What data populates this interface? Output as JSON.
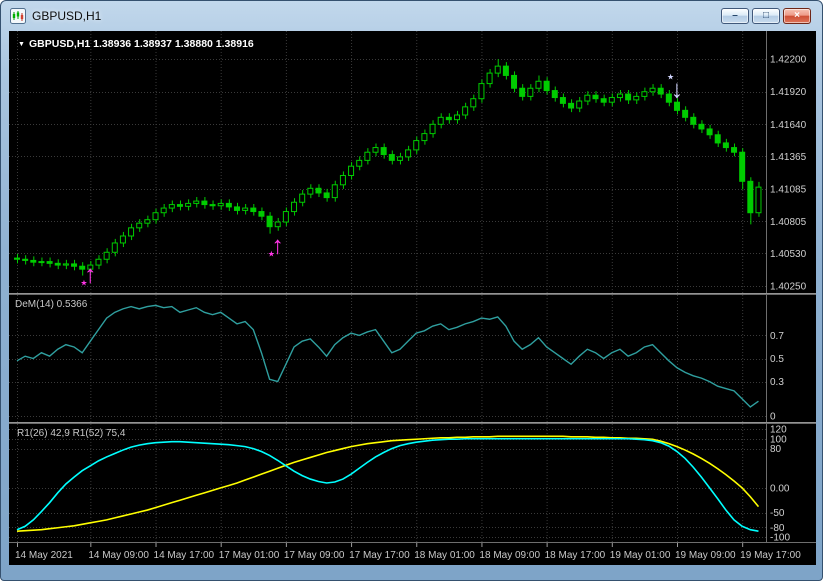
{
  "window": {
    "title": "GBPUSD,H1",
    "buttons": {
      "minimize_glyph": "–",
      "maximize_glyph": "□",
      "close_glyph": "×"
    }
  },
  "main_panel": {
    "ohlc_marker": "▼",
    "ohlc_text": "GBPUSD,H1  1.38936 1.38937 1.38880 1.38916",
    "axis": [
      [
        "1.42200",
        1.422
      ],
      [
        "1.41920",
        1.4192
      ],
      [
        "1.41640",
        1.4164
      ],
      [
        "1.41365",
        1.41365
      ],
      [
        "1.41085",
        1.41085
      ],
      [
        "1.40805",
        1.40805
      ],
      [
        "1.40530",
        1.4053
      ],
      [
        "1.40250",
        1.4025
      ]
    ],
    "range": {
      "max": 1.42442,
      "min": 1.4019
    }
  },
  "dem_panel": {
    "label": "DeM(14) 0.5366",
    "axis": [
      [
        "0.7",
        0.7
      ],
      [
        "0.5",
        0.5
      ],
      [
        "0.3",
        0.3
      ],
      [
        "0",
        0
      ]
    ],
    "range": {
      "max": 1.05,
      "min": -0.05
    }
  },
  "osc_panel": {
    "label": "R1(26) 42,9   R1(52) 75,4",
    "axis": [
      [
        "120",
        120
      ],
      [
        "100",
        100
      ],
      [
        "80",
        80
      ],
      [
        "0.00",
        0
      ],
      [
        "-50",
        -50
      ],
      [
        "-80",
        -80
      ],
      [
        "-100",
        -100
      ]
    ],
    "range": {
      "max": 130,
      "min": -110
    }
  },
  "time_axis": {
    "labels": [
      "14 May 2021",
      "14 May 09:00",
      "14 May 17:00",
      "17 May 01:00",
      "17 May 09:00",
      "17 May 17:00",
      "18 May 01:00",
      "18 May 09:00",
      "18 May 17:00",
      "19 May 01:00",
      "19 May 09:00",
      "19 May 17:00"
    ],
    "tick_indices": [
      0,
      9,
      17,
      25,
      33,
      41,
      49,
      57,
      65,
      73,
      81,
      89
    ]
  },
  "colors": {
    "bg": "#000000",
    "grid": "#3a3a3a",
    "axis_text": "#d0d0d0",
    "axis_line": "#6e6e6e",
    "candle": "#00cc00",
    "candle_bull_fill": "#000000",
    "dem_line": "#2f9f9f",
    "osc_fast": "#00ffff",
    "osc_slow": "#ffff00",
    "ohlc_text": "#ffffff",
    "label_text": "#c8c8c8",
    "time_text": "#c8c8c8",
    "tick": "#9a9a9a"
  },
  "chart_data": {
    "type": "candlestick",
    "symbol": "GBPUSD",
    "timeframe": "H1",
    "title": "GBPUSD,H1",
    "price_range": [
      1.4019,
      1.42442
    ],
    "candles": [
      [
        1.4049,
        1.40525,
        1.40445,
        1.4048
      ],
      [
        1.4048,
        1.40515,
        1.40435,
        1.4047
      ],
      [
        1.4047,
        1.40505,
        1.4042,
        1.40455
      ],
      [
        1.40455,
        1.40495,
        1.4042,
        1.4046
      ],
      [
        1.4046,
        1.40495,
        1.4041,
        1.40445
      ],
      [
        1.40445,
        1.4048,
        1.40395,
        1.4043
      ],
      [
        1.4043,
        1.40475,
        1.40395,
        1.4044
      ],
      [
        1.4044,
        1.40475,
        1.40385,
        1.4042
      ],
      [
        1.4042,
        1.40455,
        1.4034,
        1.40395
      ],
      [
        1.40395,
        1.40465,
        1.4036,
        1.4043
      ],
      [
        1.4043,
        1.40515,
        1.40395,
        1.4048
      ],
      [
        1.4048,
        1.40575,
        1.40445,
        1.4054
      ],
      [
        1.4054,
        1.40655,
        1.40505,
        1.4062
      ],
      [
        1.4062,
        1.40715,
        1.40585,
        1.4068
      ],
      [
        1.4068,
        1.40785,
        1.40645,
        1.4075
      ],
      [
        1.4075,
        1.40825,
        1.40715,
        1.4079
      ],
      [
        1.4079,
        1.40855,
        1.40755,
        1.4082
      ],
      [
        1.4082,
        1.40915,
        1.40785,
        1.4088
      ],
      [
        1.4088,
        1.40955,
        1.40845,
        1.4092
      ],
      [
        1.4092,
        1.40985,
        1.40885,
        1.4095
      ],
      [
        1.4095,
        1.40985,
        1.409,
        1.40935
      ],
      [
        1.40935,
        1.40995,
        1.409,
        1.4096
      ],
      [
        1.4096,
        1.41015,
        1.40925,
        1.4098
      ],
      [
        1.4098,
        1.41015,
        1.40915,
        1.4095
      ],
      [
        1.4095,
        1.40985,
        1.40905,
        1.4094
      ],
      [
        1.4094,
        1.40995,
        1.40905,
        1.4096
      ],
      [
        1.4096,
        1.40995,
        1.40895,
        1.4093
      ],
      [
        1.4093,
        1.40965,
        1.40865,
        1.409
      ],
      [
        1.409,
        1.40955,
        1.40865,
        1.4092
      ],
      [
        1.4092,
        1.40955,
        1.40855,
        1.4089
      ],
      [
        1.4089,
        1.40925,
        1.40815,
        1.4085
      ],
      [
        1.4085,
        1.40885,
        1.407,
        1.4076
      ],
      [
        1.4076,
        1.40835,
        1.40725,
        1.408
      ],
      [
        1.408,
        1.40925,
        1.40765,
        1.4089
      ],
      [
        1.4089,
        1.41005,
        1.40855,
        1.4097
      ],
      [
        1.4097,
        1.41075,
        1.40935,
        1.4104
      ],
      [
        1.4104,
        1.41125,
        1.41005,
        1.4109
      ],
      [
        1.4109,
        1.41125,
        1.41015,
        1.4105
      ],
      [
        1.4105,
        1.41085,
        1.40975,
        1.4101
      ],
      [
        1.4101,
        1.41155,
        1.40975,
        1.4112
      ],
      [
        1.4112,
        1.41235,
        1.41085,
        1.412
      ],
      [
        1.412,
        1.41315,
        1.41165,
        1.4128
      ],
      [
        1.4128,
        1.41365,
        1.41245,
        1.4133
      ],
      [
        1.4133,
        1.41435,
        1.41295,
        1.414
      ],
      [
        1.414,
        1.41475,
        1.41365,
        1.4144
      ],
      [
        1.4144,
        1.41475,
        1.41345,
        1.4138
      ],
      [
        1.4138,
        1.41415,
        1.41295,
        1.4133
      ],
      [
        1.4133,
        1.41395,
        1.41295,
        1.4136
      ],
      [
        1.4136,
        1.41455,
        1.41325,
        1.4142
      ],
      [
        1.4142,
        1.41535,
        1.41385,
        1.415
      ],
      [
        1.415,
        1.41595,
        1.41465,
        1.4156
      ],
      [
        1.4156,
        1.41675,
        1.41525,
        1.4164
      ],
      [
        1.4164,
        1.41735,
        1.41605,
        1.417
      ],
      [
        1.417,
        1.41735,
        1.41645,
        1.4168
      ],
      [
        1.4168,
        1.41755,
        1.41645,
        1.4172
      ],
      [
        1.4172,
        1.41825,
        1.41685,
        1.4179
      ],
      [
        1.4179,
        1.41895,
        1.41755,
        1.4186
      ],
      [
        1.4186,
        1.42025,
        1.41825,
        1.4199
      ],
      [
        1.4199,
        1.42115,
        1.41955,
        1.4208
      ],
      [
        1.4208,
        1.422,
        1.42045,
        1.4214
      ],
      [
        1.4214,
        1.42175,
        1.42025,
        1.4206
      ],
      [
        1.4206,
        1.42095,
        1.41915,
        1.4195
      ],
      [
        1.4195,
        1.41985,
        1.41845,
        1.4188
      ],
      [
        1.4188,
        1.41985,
        1.41845,
        1.4195
      ],
      [
        1.4195,
        1.4206,
        1.41915,
        1.4201
      ],
      [
        1.4201,
        1.42045,
        1.41895,
        1.4193
      ],
      [
        1.4193,
        1.41965,
        1.41835,
        1.4187
      ],
      [
        1.4187,
        1.41905,
        1.41785,
        1.4182
      ],
      [
        1.4182,
        1.41855,
        1.41745,
        1.4178
      ],
      [
        1.4178,
        1.41875,
        1.41745,
        1.4184
      ],
      [
        1.4184,
        1.41925,
        1.41805,
        1.4189
      ],
      [
        1.4189,
        1.41925,
        1.41825,
        1.4186
      ],
      [
        1.4186,
        1.41895,
        1.41795,
        1.4183
      ],
      [
        1.4183,
        1.41905,
        1.41795,
        1.4187
      ],
      [
        1.4187,
        1.41935,
        1.41835,
        1.419
      ],
      [
        1.419,
        1.41935,
        1.41815,
        1.4185
      ],
      [
        1.4185,
        1.41915,
        1.41815,
        1.4188
      ],
      [
        1.4188,
        1.41955,
        1.41845,
        1.4192
      ],
      [
        1.4192,
        1.41985,
        1.41885,
        1.4195
      ],
      [
        1.4195,
        1.41985,
        1.41865,
        1.419
      ],
      [
        1.419,
        1.41935,
        1.41795,
        1.4183
      ],
      [
        1.4183,
        1.41865,
        1.41725,
        1.4176
      ],
      [
        1.4176,
        1.41795,
        1.41665,
        1.417
      ],
      [
        1.417,
        1.41735,
        1.41605,
        1.4164
      ],
      [
        1.4164,
        1.41675,
        1.41565,
        1.416
      ],
      [
        1.416,
        1.41635,
        1.41515,
        1.4155
      ],
      [
        1.4155,
        1.41585,
        1.41445,
        1.4148
      ],
      [
        1.4148,
        1.41515,
        1.41405,
        1.4144
      ],
      [
        1.4144,
        1.41475,
        1.41365,
        1.414
      ],
      [
        1.414,
        1.41435,
        1.4108,
        1.4115
      ],
      [
        1.4115,
        1.41185,
        1.4078,
        1.4088
      ],
      [
        1.4088,
        1.41145,
        1.40845,
        1.411
      ]
    ],
    "dem": [
      0.48,
      0.52,
      0.5,
      0.55,
      0.52,
      0.58,
      0.62,
      0.6,
      0.55,
      0.65,
      0.75,
      0.85,
      0.9,
      0.93,
      0.95,
      0.93,
      0.95,
      0.96,
      0.94,
      0.95,
      0.9,
      0.92,
      0.94,
      0.9,
      0.88,
      0.9,
      0.85,
      0.8,
      0.82,
      0.75,
      0.55,
      0.32,
      0.3,
      0.45,
      0.6,
      0.65,
      0.67,
      0.6,
      0.52,
      0.62,
      0.68,
      0.72,
      0.7,
      0.73,
      0.75,
      0.65,
      0.55,
      0.58,
      0.65,
      0.72,
      0.74,
      0.78,
      0.8,
      0.75,
      0.77,
      0.8,
      0.82,
      0.85,
      0.84,
      0.86,
      0.78,
      0.65,
      0.58,
      0.62,
      0.68,
      0.6,
      0.55,
      0.5,
      0.45,
      0.52,
      0.58,
      0.55,
      0.5,
      0.55,
      0.58,
      0.52,
      0.55,
      0.6,
      0.62,
      0.55,
      0.48,
      0.42,
      0.38,
      0.35,
      0.33,
      0.3,
      0.26,
      0.24,
      0.22,
      0.15,
      0.08,
      0.13
    ],
    "osc_fast": [
      -85,
      -78,
      -65,
      -48,
      -30,
      -10,
      8,
      22,
      35,
      45,
      55,
      63,
      70,
      77,
      83,
      87,
      90,
      92,
      93,
      94,
      94,
      93,
      92,
      91,
      90,
      89,
      88,
      86,
      84,
      80,
      74,
      66,
      56,
      45,
      34,
      25,
      18,
      13,
      10,
      12,
      18,
      28,
      40,
      52,
      63,
      72,
      80,
      86,
      90,
      93,
      95,
      97,
      98,
      99,
      99,
      100,
      100,
      100,
      100,
      100,
      100,
      100,
      100,
      100,
      100,
      100,
      100,
      100,
      100,
      100,
      100,
      100,
      100,
      100,
      100,
      100,
      99,
      98,
      96,
      92,
      85,
      74,
      60,
      42,
      22,
      0,
      -22,
      -45,
      -65,
      -78,
      -85,
      -88
    ],
    "osc_slow": [
      -88,
      -87,
      -86,
      -85,
      -83,
      -81,
      -79,
      -77,
      -74,
      -71,
      -68,
      -65,
      -61,
      -57,
      -53,
      -49,
      -45,
      -40,
      -35,
      -30,
      -25,
      -20,
      -15,
      -10,
      -5,
      0,
      5,
      10,
      16,
      22,
      28,
      34,
      40,
      46,
      52,
      57,
      62,
      67,
      72,
      76,
      80,
      84,
      87,
      90,
      92,
      94,
      96,
      97,
      98,
      99,
      100,
      101,
      102,
      102,
      103,
      103,
      104,
      104,
      104,
      105,
      105,
      105,
      105,
      105,
      105,
      105,
      105,
      105,
      104,
      104,
      104,
      103,
      103,
      102,
      102,
      101,
      101,
      100,
      99,
      95,
      90,
      84,
      77,
      69,
      60,
      50,
      39,
      27,
      14,
      0,
      -18,
      -38
    ],
    "arrows": [
      {
        "bar": 9,
        "price": 1.4028,
        "dir": "up",
        "color": "#ff35e6",
        "glyph": "↑",
        "star_glyph": "★"
      },
      {
        "bar": 32,
        "price": 1.4053,
        "dir": "up",
        "color": "#ff35e6",
        "glyph": "↑",
        "star_glyph": "★"
      },
      {
        "bar": 81,
        "price": 1.4187,
        "dir": "down",
        "color": "#d2d6ff",
        "glyph": "↓",
        "star_glyph": "★"
      }
    ]
  }
}
